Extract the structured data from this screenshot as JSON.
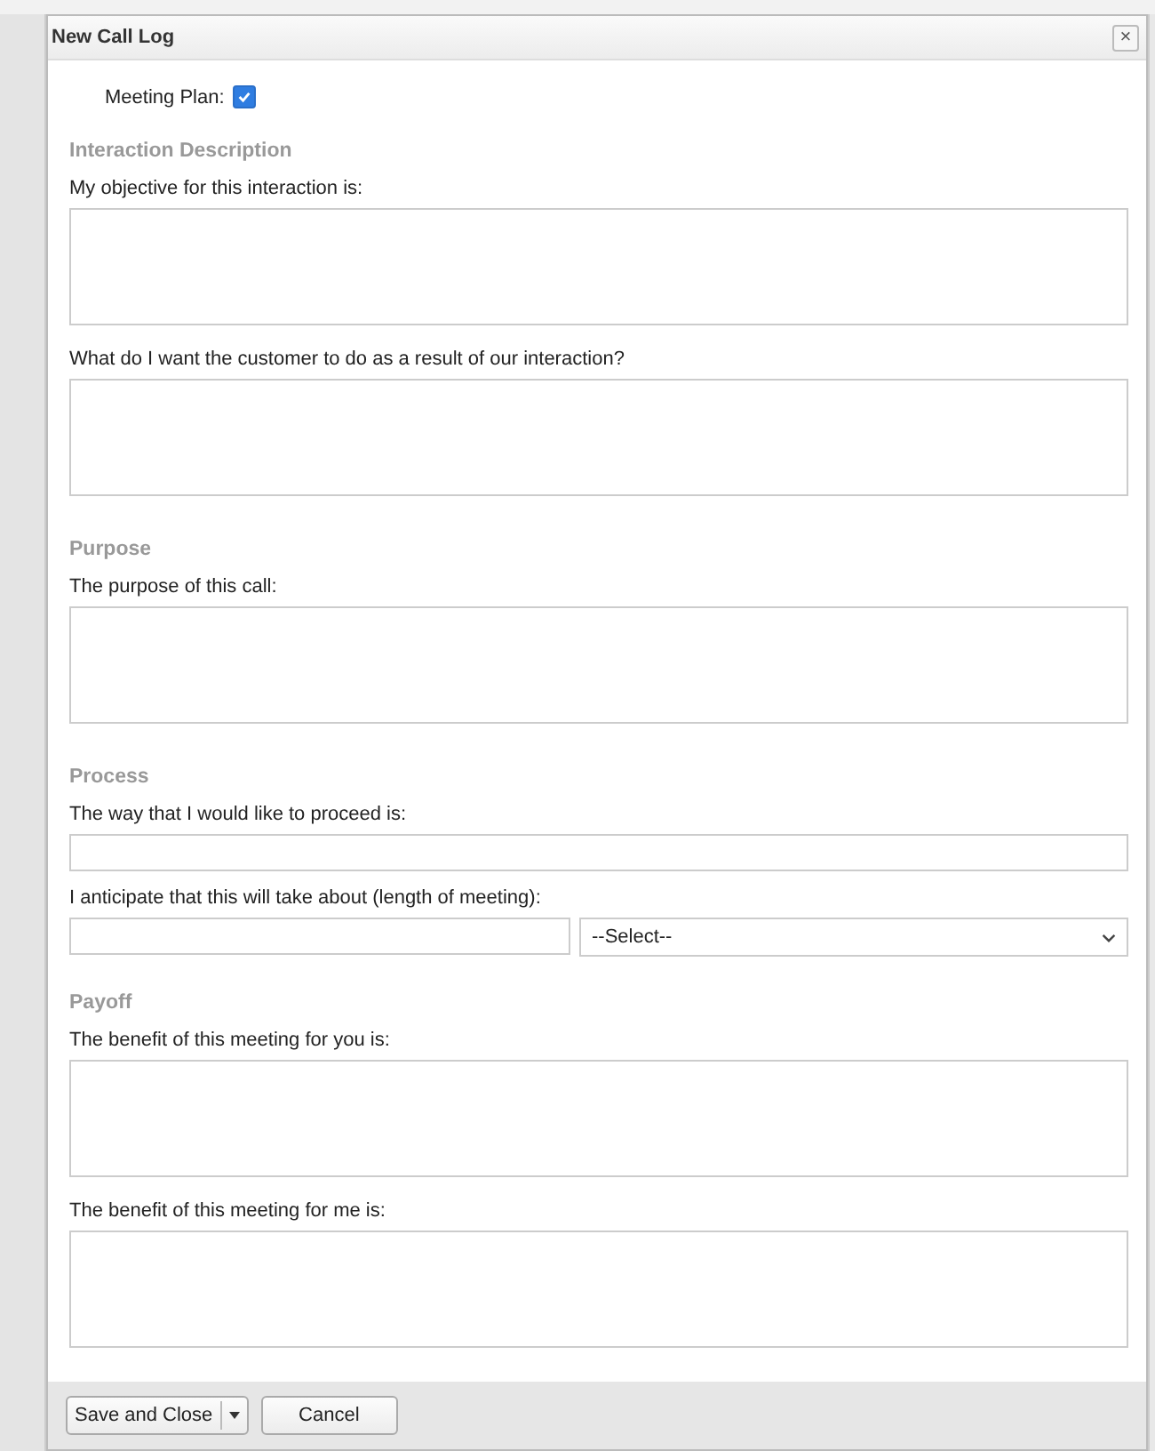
{
  "dialog": {
    "title": "New Call Log",
    "close": "×"
  },
  "meeting_plan": {
    "label": "Meeting Plan:",
    "checked": true
  },
  "sections": [
    {
      "heading": "Interaction Description",
      "fields": [
        {
          "kind": "textarea",
          "label": "My objective for this interaction is:"
        },
        {
          "kind": "textarea",
          "label": "What do I want the customer to do as a result of our interaction?"
        }
      ]
    },
    {
      "heading": "Purpose",
      "fields": [
        {
          "kind": "textarea",
          "label": "The purpose of this call:"
        }
      ]
    },
    {
      "heading": "Process",
      "fields": [
        {
          "kind": "input",
          "label": "The way that I would like to proceed is:"
        },
        {
          "kind": "input_select",
          "label": "I anticipate that this will take about (length of meeting):",
          "select": "--Select--"
        }
      ]
    },
    {
      "heading": "Payoff",
      "fields": [
        {
          "kind": "textarea",
          "label": "The benefit of this meeting for you is:"
        },
        {
          "kind": "textarea",
          "label": "The benefit of this meeting for me is:"
        }
      ]
    }
  ],
  "buttons": [
    {
      "label": "Save and Close",
      "kind": "split"
    },
    {
      "label": "Cancel",
      "kind": "plain"
    }
  ]
}
